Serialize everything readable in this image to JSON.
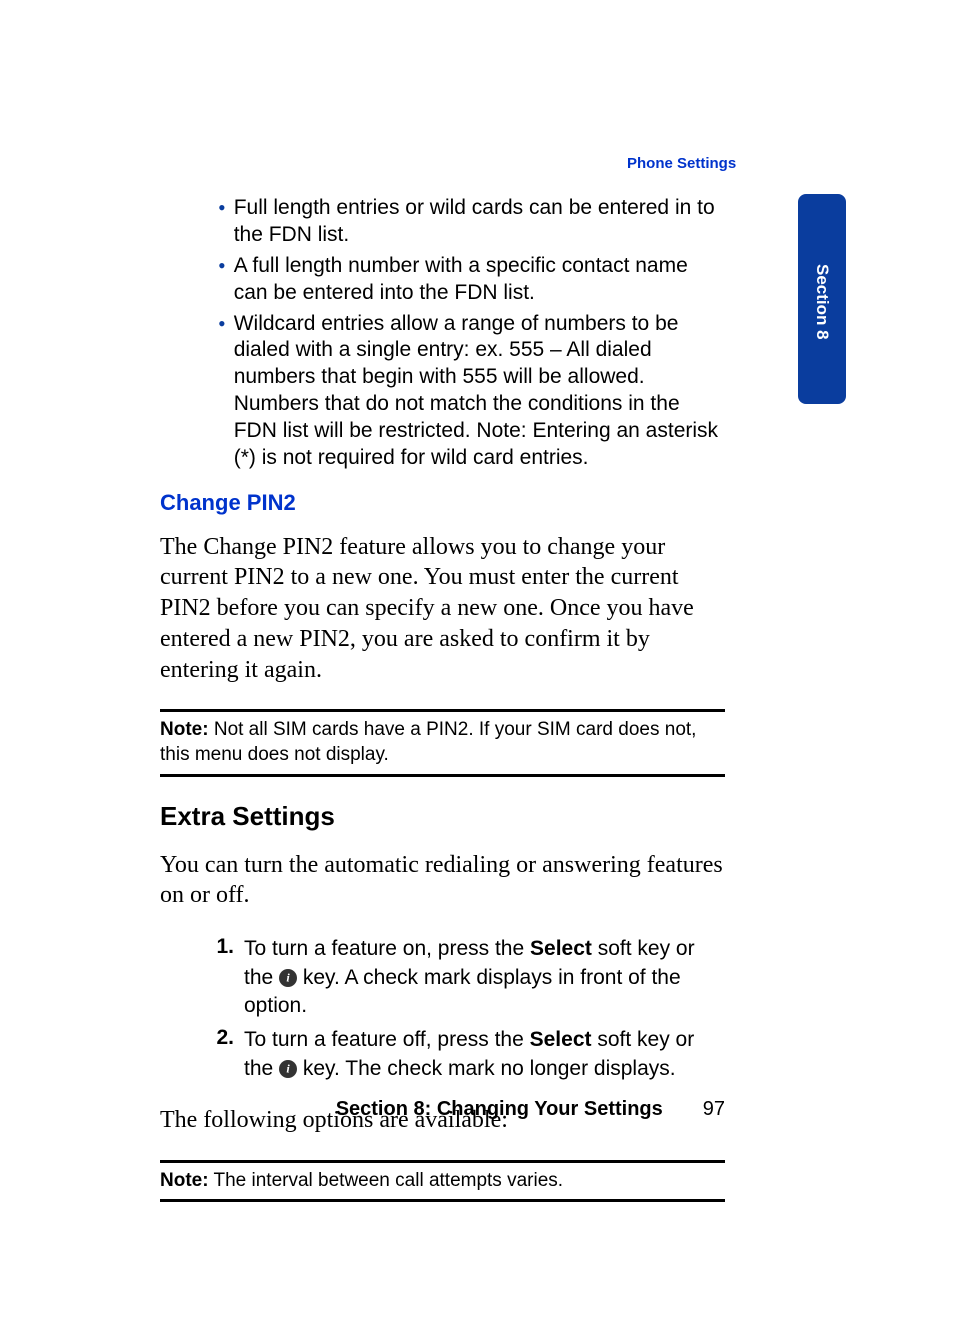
{
  "header": {
    "link": "Phone Settings"
  },
  "sideTab": {
    "label": "Section 8"
  },
  "bullets": [
    "Full length entries or wild cards can be entered in to the FDN list.",
    "A full length number with a specific contact name can be entered into the FDN list.",
    "Wildcard entries allow a range of numbers to be dialed with a single entry: ex. 555 – All dialed numbers that begin with 555 will be allowed. Numbers that do not match the conditions in the FDN list will be restricted. Note: Entering an asterisk (*) is not required for wild card entries."
  ],
  "changePin2": {
    "heading": "Change PIN2",
    "body": "The Change PIN2 feature allows you to change your current PIN2 to a new one. You must enter the current PIN2 before you can specify a new one. Once you have entered a new PIN2, you are asked to confirm it by entering it again."
  },
  "note1": {
    "label": "Note:",
    "text": " Not all SIM cards have a PIN2. If your SIM card does not, this menu does not display."
  },
  "extraSettings": {
    "heading": "Extra Settings",
    "intro": "You can turn the automatic redialing or answering features on or off."
  },
  "steps": [
    {
      "num": "1.",
      "pre": "To turn a feature on, press the ",
      "bold": "Select",
      "mid": " soft key or the ",
      "post": " key. A check mark displays in front of the option."
    },
    {
      "num": "2.",
      "pre": "To turn a feature off, press the ",
      "bold": "Select",
      "mid": " soft key or the ",
      "post": " key. The check mark no longer displays."
    }
  ],
  "followingOptions": "The following options are available:",
  "note2": {
    "label": "Note:",
    "text": " The interval between call attempts varies."
  },
  "footer": {
    "section": "Section 8: Changing Your Settings",
    "page": "97"
  }
}
